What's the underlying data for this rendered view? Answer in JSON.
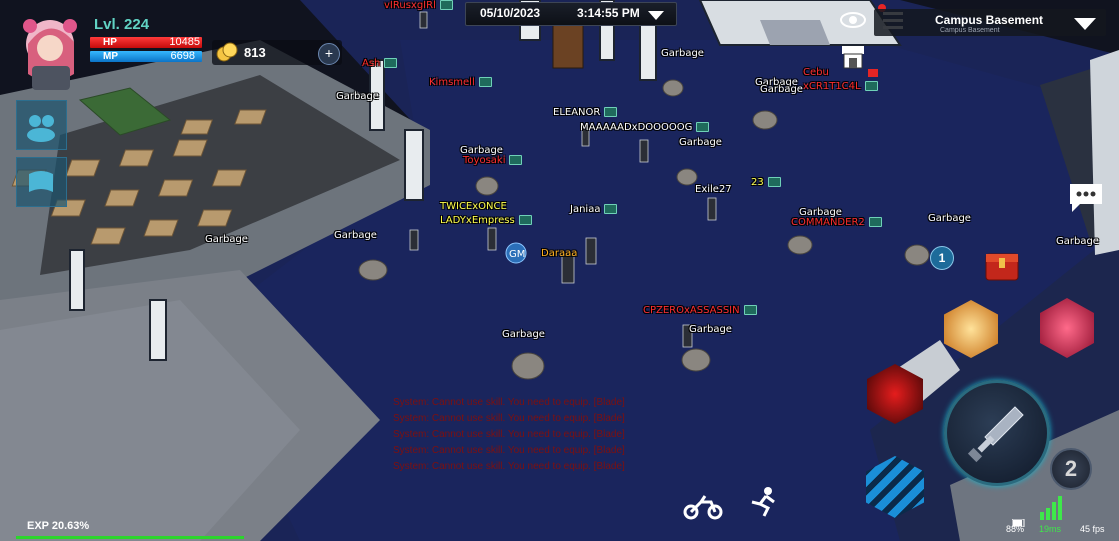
{
  "player": {
    "level": "Lvl. 224",
    "hp_label": "HP",
    "hp_value": "10485",
    "mp_label": "MP",
    "mp_value": "6698",
    "gold": "813",
    "gold_add": "+"
  },
  "topbar": {
    "date": "05/10/2023",
    "time": "3:14:55 PM"
  },
  "map": {
    "name": "Campus Basement",
    "subtitle": "Campus Basement"
  },
  "entities": [
    {
      "name": "vIRusxgIRl",
      "color": "red",
      "guild": true
    },
    {
      "name": "Ash",
      "color": "red",
      "guild": true
    },
    {
      "name": "Kimsmell",
      "color": "red",
      "guild": true
    },
    {
      "name": "Garbage",
      "color": "white",
      "guild": false
    },
    {
      "name": "Garbage",
      "color": "white",
      "guild": false
    },
    {
      "name": "Cebu",
      "color": "red",
      "guild": false
    },
    {
      "name": "Garbage",
      "color": "white",
      "guild": false
    },
    {
      "name": "xCR1T1C4L",
      "color": "red",
      "guild": true
    },
    {
      "name": "ELEANOR",
      "color": "white",
      "guild": true
    },
    {
      "name": "MAAAAADxDOOOOOG",
      "color": "white",
      "guild": true
    },
    {
      "name": "Garbage",
      "color": "white",
      "guild": false
    },
    {
      "name": "Garbage",
      "color": "white",
      "guild": false
    },
    {
      "name": "Garbage",
      "color": "white",
      "guild": false
    },
    {
      "name": "Toyosaki",
      "color": "red",
      "guild": true
    },
    {
      "name": "Exile27",
      "color": "white",
      "guild": true
    },
    {
      "name": "23",
      "color": "yellow",
      "guild": true
    },
    {
      "name": "TWICExONCE",
      "color": "yellow",
      "guild": false
    },
    {
      "name": "LADYxEmpress",
      "color": "yellow",
      "guild": true
    },
    {
      "name": "Janiaa",
      "color": "white",
      "guild": true
    },
    {
      "name": "Garbage",
      "color": "white",
      "guild": false
    },
    {
      "name": "COMMANDER2",
      "color": "red",
      "guild": true
    },
    {
      "name": "Garbage",
      "color": "white",
      "guild": false
    },
    {
      "name": "Garbage",
      "color": "white",
      "guild": false
    },
    {
      "name": "Garbage",
      "color": "white",
      "guild": false
    },
    {
      "name": "Daraaa",
      "color": "orange",
      "guild": false
    },
    {
      "name": "CPZEROxASSASSIN",
      "color": "red",
      "guild": true
    },
    {
      "name": "Garbage",
      "color": "white",
      "guild": false
    },
    {
      "name": "Garbage",
      "color": "white",
      "guild": false
    },
    {
      "name": "Garbage",
      "color": "white",
      "guild": false
    }
  ],
  "system_log": [
    "System: Cannot use skill. You need to equip. [Blade]",
    "System: Cannot use skill. You need to equip. [Blade]",
    "System: Cannot use skill. You need to equip. [Blade]",
    "System: Cannot use skill. You need to equip. [Blade]",
    "System: Cannot use skill. You need to equip. [Blade]"
  ],
  "hud": {
    "exp": "EXP 20.63%",
    "exp_fraction": 0.2063,
    "battery": "88%",
    "ping": "19ms",
    "fps": "45 fps",
    "skill_page": "2",
    "quest_badge": "1"
  },
  "colors": {
    "hp": "#e21b1b",
    "mp": "#1f9be8",
    "exp": "#2cd52c",
    "level": "#61d3c4",
    "name_red": "#ff2d2d",
    "name_yellow": "#ffff4a",
    "name_orange": "#ffb020"
  },
  "icons": [
    "avatar",
    "gold-coin-icon",
    "eye-icon",
    "menu-icon",
    "chevron-down-icon",
    "chat-icon",
    "shop-icon",
    "motorcycle-icon",
    "run-icon",
    "sword-icon",
    "guild-icon",
    "gm-icon",
    "chest-icon"
  ]
}
